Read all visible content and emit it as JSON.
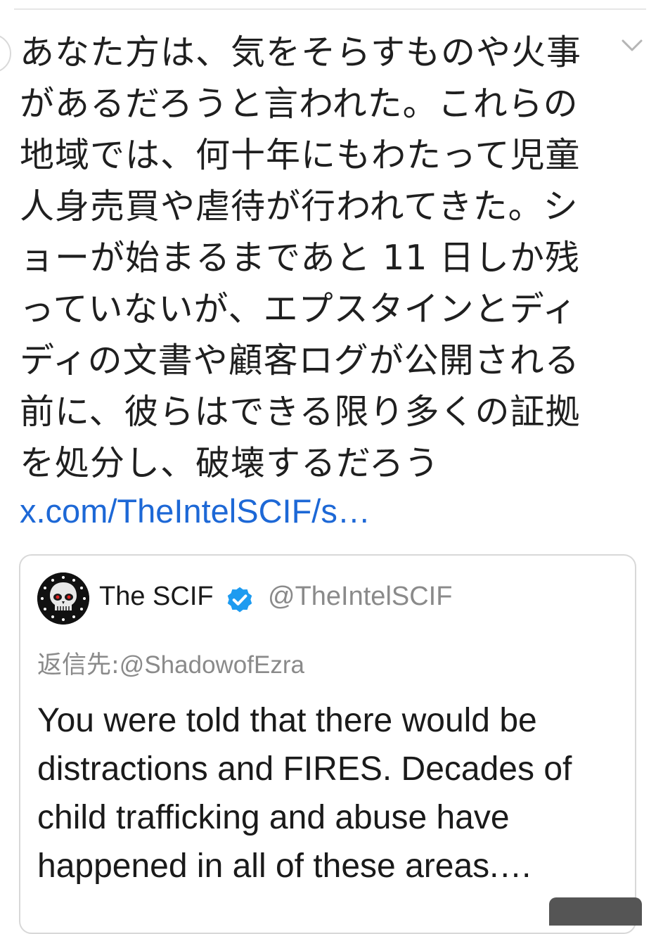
{
  "tweet": {
    "text": "あなた方は、気をそらすものや火事\nがあるだろうと言われた。これらの\n地域では、何十年にもわたって児童\n人身売買や虐待が行われてきた。シ\nョーが始まるまであと 11 日しか残\nっていないが、エプスタインとディ\nディの文書や顧客ログが公開される\n前に、彼らはできる限り多くの証拠\nを処分し、破壊するだろう",
    "link": "x.com/TheIntelSCIF/s…"
  },
  "quoted_tweet": {
    "name": "The SCIF",
    "handle": "@TheIntelSCIF",
    "reply_prefix": "返信先:",
    "reply_to": "@ShadowofEzra",
    "text": "You were told that there would be\ndistractions and FIRES. Decades of\nchild trafficking and abuse have\nhappened in all of these areas.…"
  },
  "icons": {
    "chevron": "chevron-down-icon",
    "verified": "verified-badge-icon",
    "avatar": "skull-avatar"
  },
  "colors": {
    "link": "#1d68d6",
    "verified": "#1d9bf0",
    "muted": "#8a8a8a"
  }
}
